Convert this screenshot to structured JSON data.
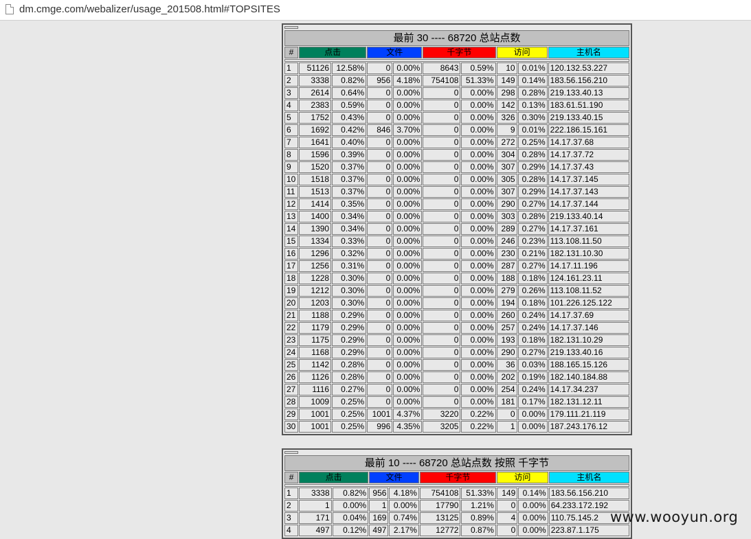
{
  "browser": {
    "url": "dm.cmge.com/webalizer/usage_201508.html#TOPSITES"
  },
  "colors": {
    "hits": "#00805c",
    "files": "#0040ff",
    "kbytes": "#ff0000",
    "visits": "#ffff00",
    "hostname": "#00e0ff"
  },
  "columns": {
    "num": "#",
    "hits": "点击",
    "files": "文件",
    "kbytes": "千字节",
    "visits": "访问",
    "hostname": "主机名"
  },
  "table1": {
    "title": "最前 30 ---- 68720 总站点数",
    "rows": [
      [
        "1",
        "51126",
        "12.58%",
        "0",
        "0.00%",
        "8643",
        "0.59%",
        "10",
        "0.01%",
        "120.132.53.227"
      ],
      [
        "2",
        "3338",
        "0.82%",
        "956",
        "4.18%",
        "754108",
        "51.33%",
        "149",
        "0.14%",
        "183.56.156.210"
      ],
      [
        "3",
        "2614",
        "0.64%",
        "0",
        "0.00%",
        "0",
        "0.00%",
        "298",
        "0.28%",
        "219.133.40.13"
      ],
      [
        "4",
        "2383",
        "0.59%",
        "0",
        "0.00%",
        "0",
        "0.00%",
        "142",
        "0.13%",
        "183.61.51.190"
      ],
      [
        "5",
        "1752",
        "0.43%",
        "0",
        "0.00%",
        "0",
        "0.00%",
        "326",
        "0.30%",
        "219.133.40.15"
      ],
      [
        "6",
        "1692",
        "0.42%",
        "846",
        "3.70%",
        "0",
        "0.00%",
        "9",
        "0.01%",
        "222.186.15.161"
      ],
      [
        "7",
        "1641",
        "0.40%",
        "0",
        "0.00%",
        "0",
        "0.00%",
        "272",
        "0.25%",
        "14.17.37.68"
      ],
      [
        "8",
        "1596",
        "0.39%",
        "0",
        "0.00%",
        "0",
        "0.00%",
        "304",
        "0.28%",
        "14.17.37.72"
      ],
      [
        "9",
        "1520",
        "0.37%",
        "0",
        "0.00%",
        "0",
        "0.00%",
        "307",
        "0.29%",
        "14.17.37.43"
      ],
      [
        "10",
        "1518",
        "0.37%",
        "0",
        "0.00%",
        "0",
        "0.00%",
        "305",
        "0.28%",
        "14.17.37.145"
      ],
      [
        "11",
        "1513",
        "0.37%",
        "0",
        "0.00%",
        "0",
        "0.00%",
        "307",
        "0.29%",
        "14.17.37.143"
      ],
      [
        "12",
        "1414",
        "0.35%",
        "0",
        "0.00%",
        "0",
        "0.00%",
        "290",
        "0.27%",
        "14.17.37.144"
      ],
      [
        "13",
        "1400",
        "0.34%",
        "0",
        "0.00%",
        "0",
        "0.00%",
        "303",
        "0.28%",
        "219.133.40.14"
      ],
      [
        "14",
        "1390",
        "0.34%",
        "0",
        "0.00%",
        "0",
        "0.00%",
        "289",
        "0.27%",
        "14.17.37.161"
      ],
      [
        "15",
        "1334",
        "0.33%",
        "0",
        "0.00%",
        "0",
        "0.00%",
        "246",
        "0.23%",
        "113.108.11.50"
      ],
      [
        "16",
        "1296",
        "0.32%",
        "0",
        "0.00%",
        "0",
        "0.00%",
        "230",
        "0.21%",
        "182.131.10.30"
      ],
      [
        "17",
        "1256",
        "0.31%",
        "0",
        "0.00%",
        "0",
        "0.00%",
        "287",
        "0.27%",
        "14.17.11.196"
      ],
      [
        "18",
        "1228",
        "0.30%",
        "0",
        "0.00%",
        "0",
        "0.00%",
        "188",
        "0.18%",
        "124.161.23.11"
      ],
      [
        "19",
        "1212",
        "0.30%",
        "0",
        "0.00%",
        "0",
        "0.00%",
        "279",
        "0.26%",
        "113.108.11.52"
      ],
      [
        "20",
        "1203",
        "0.30%",
        "0",
        "0.00%",
        "0",
        "0.00%",
        "194",
        "0.18%",
        "101.226.125.122"
      ],
      [
        "21",
        "1188",
        "0.29%",
        "0",
        "0.00%",
        "0",
        "0.00%",
        "260",
        "0.24%",
        "14.17.37.69"
      ],
      [
        "22",
        "1179",
        "0.29%",
        "0",
        "0.00%",
        "0",
        "0.00%",
        "257",
        "0.24%",
        "14.17.37.146"
      ],
      [
        "23",
        "1175",
        "0.29%",
        "0",
        "0.00%",
        "0",
        "0.00%",
        "193",
        "0.18%",
        "182.131.10.29"
      ],
      [
        "24",
        "1168",
        "0.29%",
        "0",
        "0.00%",
        "0",
        "0.00%",
        "290",
        "0.27%",
        "219.133.40.16"
      ],
      [
        "25",
        "1142",
        "0.28%",
        "0",
        "0.00%",
        "0",
        "0.00%",
        "36",
        "0.03%",
        "188.165.15.126"
      ],
      [
        "26",
        "1126",
        "0.28%",
        "0",
        "0.00%",
        "0",
        "0.00%",
        "202",
        "0.19%",
        "182.140.184.88"
      ],
      [
        "27",
        "1116",
        "0.27%",
        "0",
        "0.00%",
        "0",
        "0.00%",
        "254",
        "0.24%",
        "14.17.34.237"
      ],
      [
        "28",
        "1009",
        "0.25%",
        "0",
        "0.00%",
        "0",
        "0.00%",
        "181",
        "0.17%",
        "182.131.12.11"
      ],
      [
        "29",
        "1001",
        "0.25%",
        "1001",
        "4.37%",
        "3220",
        "0.22%",
        "0",
        "0.00%",
        "179.111.21.119"
      ],
      [
        "30",
        "1001",
        "0.25%",
        "996",
        "4.35%",
        "3205",
        "0.22%",
        "1",
        "0.00%",
        "187.243.176.12"
      ]
    ]
  },
  "table2": {
    "title": "最前 10 ---- 68720 总站点数 按照 千字节",
    "rows": [
      [
        "1",
        "3338",
        "0.82%",
        "956",
        "4.18%",
        "754108",
        "51.33%",
        "149",
        "0.14%",
        "183.56.156.210"
      ],
      [
        "2",
        "1",
        "0.00%",
        "1",
        "0.00%",
        "17790",
        "1.21%",
        "0",
        "0.00%",
        "64.233.172.192"
      ],
      [
        "3",
        "171",
        "0.04%",
        "169",
        "0.74%",
        "13125",
        "0.89%",
        "4",
        "0.00%",
        "110.75.145.2"
      ],
      [
        "4",
        "497",
        "0.12%",
        "497",
        "2.17%",
        "12772",
        "0.87%",
        "0",
        "0.00%",
        "223.87.1.175"
      ]
    ]
  },
  "watermark": "www.wooyun.org"
}
